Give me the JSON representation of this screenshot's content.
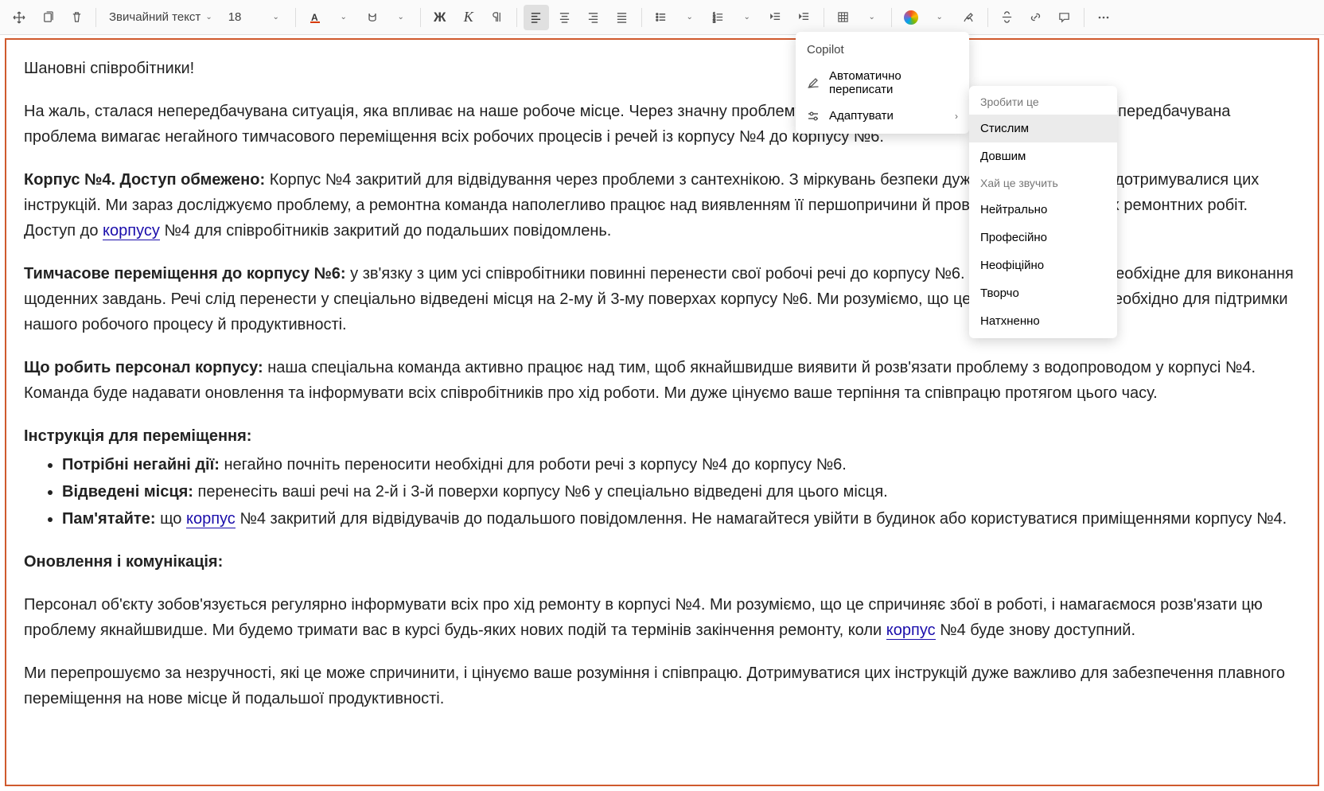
{
  "toolbar": {
    "styleName": "Звичайний текст",
    "fontSize": "18",
    "bold": "Ж",
    "italic": "К"
  },
  "copilotMenu": {
    "title": "Copilot",
    "rewrite": "Автоматично переписати",
    "adapt": "Адаптувати"
  },
  "submenu": {
    "header": "Зробити це",
    "items": [
      "Стислим",
      "Довшим",
      "Хай це звучить",
      "Нейтрально",
      "Професійно",
      "Неофіційно",
      "Творчо",
      "Натхненно"
    ]
  },
  "doc": {
    "greeting": "Шановні співробітники!",
    "p2": "На жаль, сталася непередбачувана ситуація, яка впливає на наше робоче місце. Через значну проблему із сантехнікою корпус №4 закритий. Ця непередбачувана проблема вимагає негайного тимчасового переміщення всіх робочих процесів і речей із корпусу №4 до корпусу №6.",
    "h3": "Корпус №4. Доступ обмежено:",
    "p3a": " Корпус №4 закритий для відвідування через проблеми з сантехнікою. З міркувань безпеки дуже важливо, щоб усі дотримувалися цих інструкцій. Ми зараз досліджуємо проблему, а ремонтна команда наполегливо працює над виявленням її першопричини й проведенням необхідних ремонтних робіт. Доступ до ",
    "p3link": "корпусу",
    "p3b": " №4 для співробітників закритий до подальших повідомлень.",
    "h4": "Тимчасове переміщення до корпусу №6:",
    "p4": " у зв'язку з цим усі співробітники повинні перенести свої робочі речі до корпусу №6. Сюди входить усе необхідне для виконання щоденних завдань. Речі слід перенести у спеціально відведені місця на 2-му й 3-му поверхах корпусу №6. Ми розуміємо, що це незручно, але це необхідно для підтримки нашого робочого процесу й продуктивності.",
    "h5": "Що робить персонал корпусу:",
    "p5": " наша спеціальна команда активно працює над тим, щоб якнайшвидше виявити й розв'язати проблему з водопроводом у корпусі №4. Команда буде надавати оновлення та інформувати всіх співробітників про хід роботи. Ми дуже цінуємо ваше терпіння та співпрацю протягом цього часу.",
    "h6": "Інструкція для переміщення:",
    "li1b": "Потрібні негайні дії:",
    "li1": " негайно почніть переносити необхідні для роботи речі з корпусу №4 до корпусу №6.",
    "li2b": "Відведені місця:",
    "li2": " перенесіть ваші речі на 2-й і 3-й поверхи корпусу №6 у спеціально відведені для цього місця.",
    "li3b": "Пам'ятайте:",
    "li3a": " що ",
    "li3link": "корпус",
    "li3t": " №4 закритий для відвідувачів до подальшого повідомлення. Не намагайтеся увійти в будинок або користуватися приміщеннями корпусу №4.",
    "h7": "Оновлення і комунікація:",
    "p7a": "Персонал об'єкту зобов'язується регулярно інформувати всіх про хід ремонту в корпусі №4. Ми розуміємо, що це спричиняє збої в роботі, і намагаємося розв'язати цю проблему якнайшвидше. Ми будемо тримати вас в курсі будь-яких нових подій та термінів закінчення ремонту, коли ",
    "p7link": "корпус",
    "p7b": " №4 буде знову доступний.",
    "p8": "Ми перепрошуємо за незручності, які це може спричинити, і цінуємо ваше розуміння і співпрацю. Дотримуватися цих інструкцій дуже важливо для забезпечення плавного переміщення на нове місце й подальшої продуктивності."
  }
}
